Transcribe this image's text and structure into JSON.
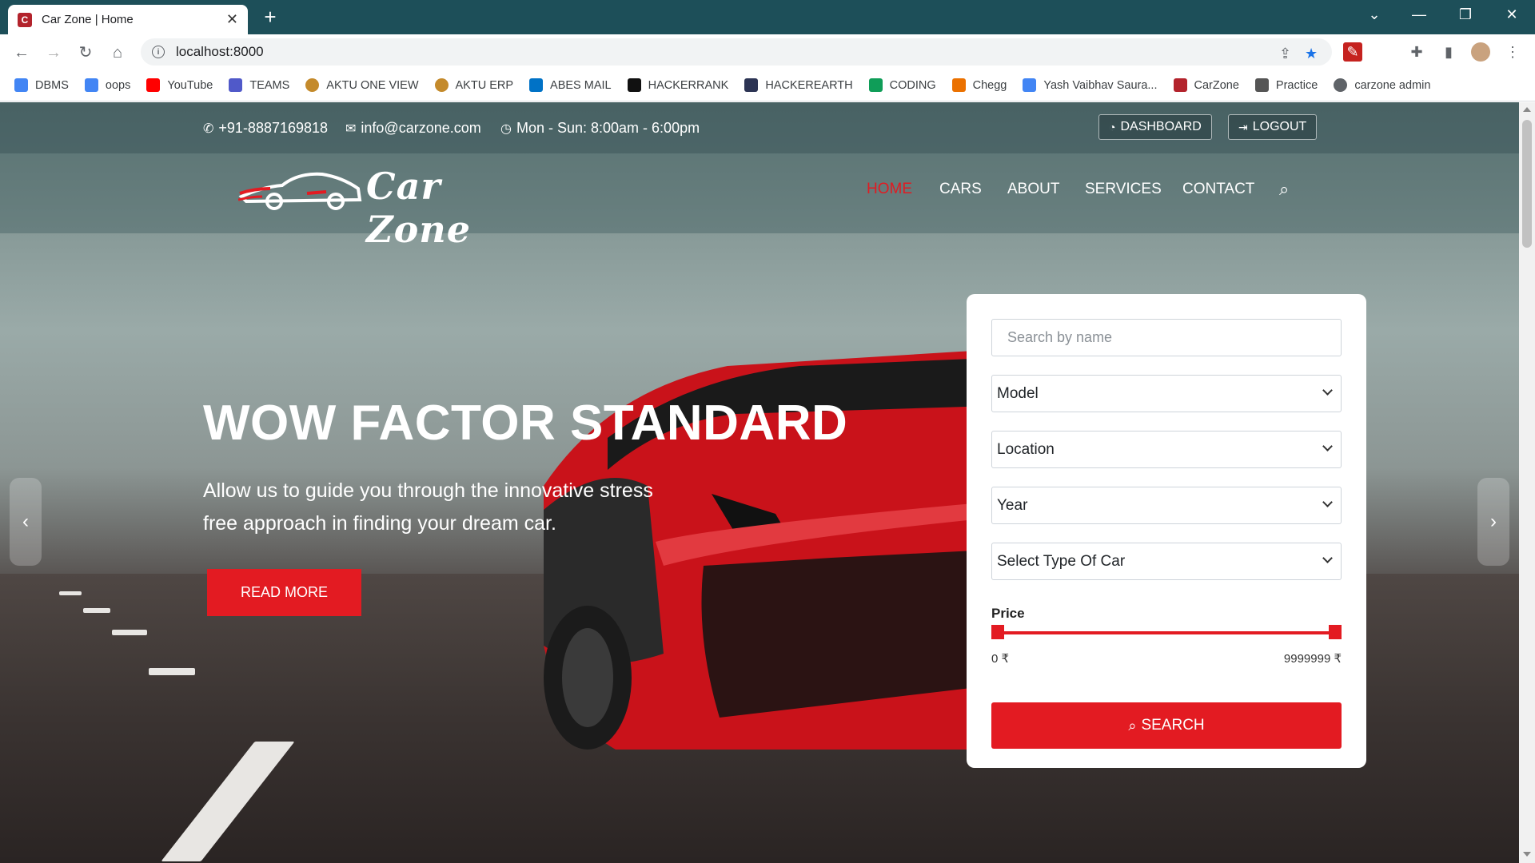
{
  "browser": {
    "tab_title": "Car Zone | Home",
    "favicon_letter": "C",
    "url": "localhost:8000",
    "bookmarks": [
      {
        "label": "DBMS",
        "color": "#4285f4"
      },
      {
        "label": "oops",
        "color": "#4285f4"
      },
      {
        "label": "YouTube",
        "color": "#ff0000"
      },
      {
        "label": "TEAMS",
        "color": "#5059c9"
      },
      {
        "label": "AKTU ONE VIEW",
        "color": "#c48a2b"
      },
      {
        "label": "AKTU ERP",
        "color": "#c48a2b"
      },
      {
        "label": "ABES MAIL",
        "color": "#0072c6"
      },
      {
        "label": "HACKERRANK",
        "color": "#111111"
      },
      {
        "label": "HACKEREARTH",
        "color": "#2c3454"
      },
      {
        "label": "CODING",
        "color": "#0f9d58"
      },
      {
        "label": "Chegg",
        "color": "#eb7100"
      },
      {
        "label": "Yash Vaibhav Saura...",
        "color": "#4285f4"
      },
      {
        "label": "CarZone",
        "color": "#b3232c"
      },
      {
        "label": "Practice",
        "color": "#555555"
      },
      {
        "label": "carzone admin",
        "color": "#5f6368"
      }
    ]
  },
  "topbar": {
    "phone": "+91-8887169818",
    "email": "info@carzone.com",
    "hours": "Mon - Sun: 8:00am - 6:00pm",
    "dashboard_label": "DASHBOARD",
    "logout_label": "LOGOUT"
  },
  "logo": {
    "text": "Car Zone"
  },
  "nav": {
    "home": "HOME",
    "cars": "CARS",
    "about": "ABOUT",
    "services": "SERVICES",
    "contact": "CONTACT"
  },
  "hero": {
    "title": "WOW FACTOR STANDARD",
    "subtitle": "Allow us to guide you through the innovative stress free approach in finding your dream car.",
    "button": "READ MORE"
  },
  "search": {
    "name_placeholder": "Search by name",
    "model": "Model",
    "location": "Location",
    "year": "Year",
    "type": "Select Type Of Car",
    "price_label": "Price",
    "price_min": "0 ₹",
    "price_max": "9999999 ₹",
    "button": "SEARCH"
  },
  "colors": {
    "accent": "#e31b22",
    "tabbar": "#1d4f59"
  }
}
